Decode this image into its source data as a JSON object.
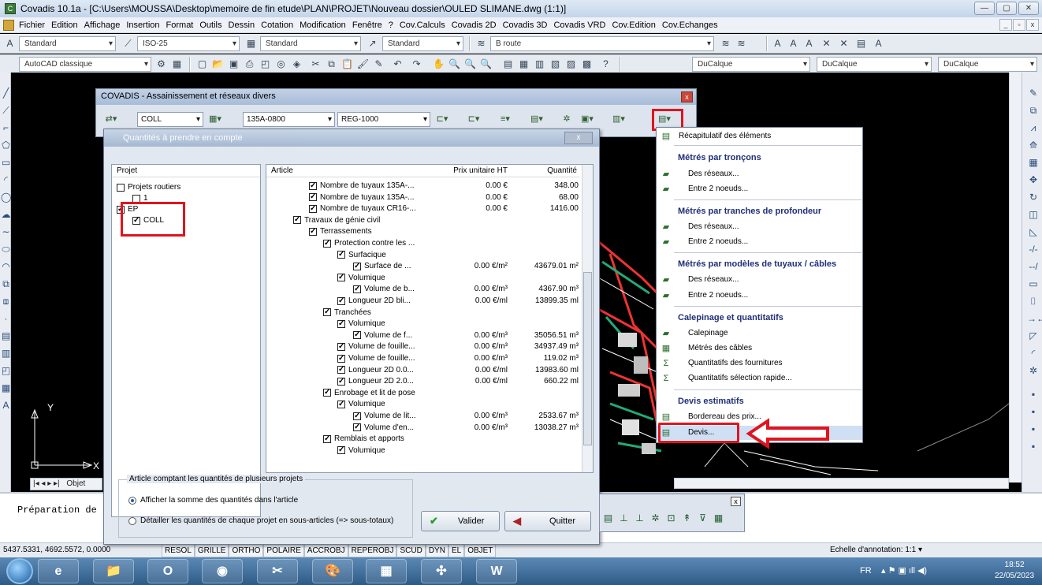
{
  "titlebar": {
    "title": "Covadis 10.1a - [C:\\Users\\MOUSSA\\Desktop\\memoire de fin etude\\PLAN\\PROJET\\Nouveau dossier\\OULED SLIMANE.dwg (1:1)]",
    "buttons": [
      "—",
      "▢",
      "✕"
    ]
  },
  "menubar": {
    "items": [
      "Fichier",
      "Edition",
      "Affichage",
      "Insertion",
      "Format",
      "Outils",
      "Dessin",
      "Cotation",
      "Modification",
      "Fenêtre",
      "?",
      "Cov.Calculs",
      "Covadis 2D",
      "Covadis 3D",
      "Covadis VRD",
      "Cov.Edition",
      "Cov.Echanges"
    ],
    "mdi_buttons": [
      "_",
      "▫",
      "x"
    ]
  },
  "toolbar1": {
    "style1": "Standard",
    "dimstyle": "ISO-25",
    "tablestyle": "Standard",
    "mleaderstyle": "Standard",
    "layer": "B route"
  },
  "toolbar2": {
    "workspace": "AutoCAD classique",
    "color": "DuCalque",
    "linetype": "DuCalque",
    "lineweight": "DuCalque"
  },
  "covadis_toolbar": {
    "title": "COVADIS - Assainissement et réseaux divers",
    "network": "COLL",
    "pipe": "135A-0800",
    "manhole": "REG-1000",
    "close": "x"
  },
  "dialog": {
    "title": "Quantités à prendre en compte",
    "close": "x",
    "projects_header": "Projet",
    "projects": [
      {
        "label": "Projets routiers",
        "checked": false,
        "level": 0
      },
      {
        "label": "1",
        "checked": false,
        "level": 1
      },
      {
        "label": "EP",
        "checked": true,
        "level": 0
      },
      {
        "label": "COLL",
        "checked": true,
        "level": 1
      }
    ],
    "articles_header": {
      "article": "Article",
      "price": "Prix unitaire HT",
      "qty": "Quantité"
    },
    "articles": [
      {
        "label": "Nombre de tuyaux 135A-...",
        "level": 2,
        "price": "0.00 €",
        "qty": "348.00"
      },
      {
        "label": "Nombre de tuyaux 135A-...",
        "level": 2,
        "price": "0.00 €",
        "qty": "68.00"
      },
      {
        "label": "Nombre de tuyaux CR16-...",
        "level": 2,
        "price": "0.00 €",
        "qty": "1416.00"
      },
      {
        "label": "Travaux de génie civil",
        "level": 1,
        "price": "",
        "qty": ""
      },
      {
        "label": "Terrassements",
        "level": 2,
        "price": "",
        "qty": ""
      },
      {
        "label": "Protection contre les ...",
        "level": 3,
        "price": "",
        "qty": ""
      },
      {
        "label": "Surfacique",
        "level": 4,
        "price": "",
        "qty": ""
      },
      {
        "label": "Surface de ...",
        "level": 5,
        "price": "0.00 €/m²",
        "qty": "43679.01 m²"
      },
      {
        "label": "Volumique",
        "level": 4,
        "price": "",
        "qty": ""
      },
      {
        "label": "Volume de b...",
        "level": 5,
        "price": "0.00 €/m³",
        "qty": "4367.90 m³"
      },
      {
        "label": "Longueur 2D bli...",
        "level": 4,
        "price": "0.00 €/ml",
        "qty": "13899.35 ml"
      },
      {
        "label": "Tranchées",
        "level": 3,
        "price": "",
        "qty": ""
      },
      {
        "label": "Volumique",
        "level": 4,
        "price": "",
        "qty": ""
      },
      {
        "label": "Volume de f...",
        "level": 5,
        "price": "0.00 €/m³",
        "qty": "35056.51 m³"
      },
      {
        "label": "Volume de fouille...",
        "level": 4,
        "price": "0.00 €/m³",
        "qty": "34937.49 m³"
      },
      {
        "label": "Volume de fouille...",
        "level": 4,
        "price": "0.00 €/m³",
        "qty": "119.02 m³"
      },
      {
        "label": "Longueur 2D 0.0...",
        "level": 4,
        "price": "0.00 €/ml",
        "qty": "13983.60 ml"
      },
      {
        "label": "Longueur 2D 2.0...",
        "level": 4,
        "price": "0.00 €/ml",
        "qty": "660.22 ml"
      },
      {
        "label": "Enrobage et lit de pose",
        "level": 3,
        "price": "",
        "qty": ""
      },
      {
        "label": "Volumique",
        "level": 4,
        "price": "",
        "qty": ""
      },
      {
        "label": "Volume de lit...",
        "level": 5,
        "price": "0.00 €/m³",
        "qty": "2533.67 m³"
      },
      {
        "label": "Volume d'en...",
        "level": 5,
        "price": "0.00 €/m³",
        "qty": "13038.27 m³"
      },
      {
        "label": "Remblais et apports",
        "level": 3,
        "price": "",
        "qty": ""
      },
      {
        "label": "Volumique",
        "level": 4,
        "price": "",
        "qty": ""
      }
    ],
    "group_label": "Article comptant les quantités de plusieurs projets",
    "option1": "Afficher la somme des quantités dans l'article",
    "option2": "Détailler les quantités de chaque projet en sous-articles (=> sous-totaux)",
    "selected_option": 1,
    "ok_button": "Valider",
    "cancel_button": "Quitter"
  },
  "context_menu": {
    "top_item": "Récapitulatif des éléments",
    "sections": [
      {
        "heading": "Métrés par tronçons",
        "items": [
          "Des réseaux...",
          "Entre 2 noeuds..."
        ]
      },
      {
        "heading": "Métrés par tranches de profondeur",
        "items": [
          "Des réseaux...",
          "Entre 2 noeuds..."
        ]
      },
      {
        "heading": "Métrés par modèles de tuyaux / câbles",
        "items": [
          "Des réseaux...",
          "Entre 2 noeuds..."
        ]
      },
      {
        "heading": "Calepinage et quantitatifs",
        "items": [
          "Calepinage",
          "Métrés des câbles",
          "Quantitatifs des fournitures",
          "Quantitatifs sélection rapide..."
        ]
      },
      {
        "heading": "Devis estimatifs",
        "items": [
          "Bordereau des prix...",
          "Devis..."
        ]
      }
    ],
    "highlighted": "Devis..."
  },
  "canvas": {
    "ucs_y": "Y",
    "ucs_x": "X"
  },
  "layout_tabs": {
    "nav": "|◂ ◂ ▸ ▸|",
    "tab": "Objet"
  },
  "command_line": {
    "prompt": "Préparation de"
  },
  "statusbar": {
    "coords": "5437.5331, 4692.5572, 0.0000",
    "toggles": [
      "RESOL",
      "GRILLE",
      "ORTHO",
      "POLAIRE",
      "ACCROBJ",
      "REPEROBJ",
      "SCUD",
      "DYN",
      "EL",
      "OBJET"
    ],
    "annotation": "Echelle d'annotation: 1:1 ▾"
  },
  "taskbar": {
    "apps": [
      "e",
      "📁",
      "O",
      "◉",
      "✂",
      "🎨",
      "▦",
      "✣",
      "W"
    ],
    "lang": "FR",
    "time": "18:52",
    "date": "22/05/2023"
  },
  "colors": {
    "red_highlight": "#e0141e",
    "menu_heading": "#1f2f78",
    "cad_background": "#000000"
  }
}
